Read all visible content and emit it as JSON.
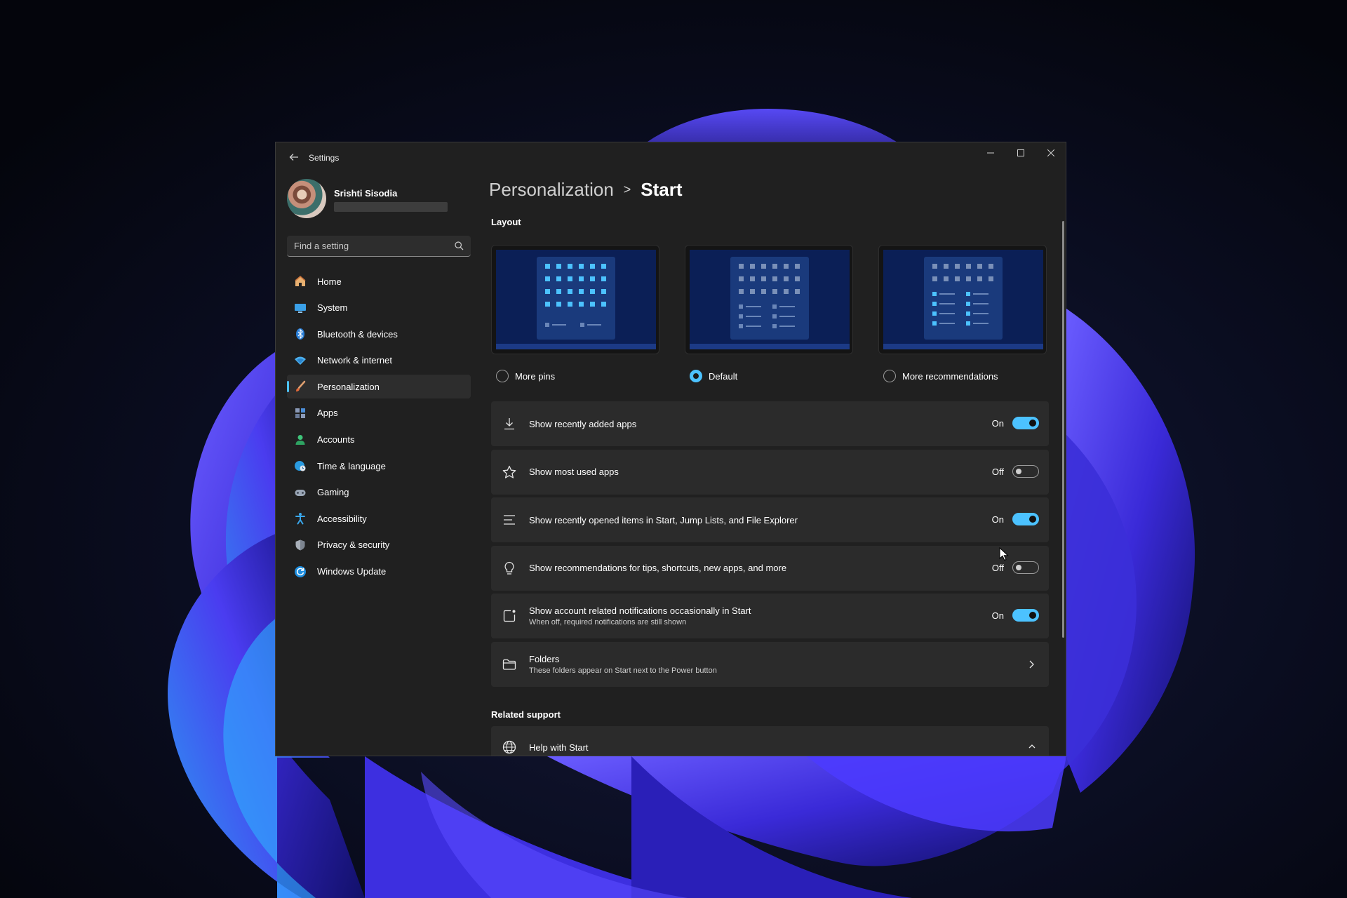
{
  "app": {
    "title": "Settings",
    "accent_color": "#4cc2ff"
  },
  "window_controls": [
    "minimize-icon",
    "maximize-icon",
    "close-icon"
  ],
  "profile": {
    "name": "Srishti Sisodia"
  },
  "search": {
    "placeholder": "Find a setting"
  },
  "sidebar": {
    "items": [
      {
        "label": "Home",
        "icon": "home-icon",
        "selected": false
      },
      {
        "label": "System",
        "icon": "system-icon",
        "selected": false
      },
      {
        "label": "Bluetooth & devices",
        "icon": "bluetooth-icon",
        "selected": false
      },
      {
        "label": "Network & internet",
        "icon": "wifi-icon",
        "selected": false
      },
      {
        "label": "Personalization",
        "icon": "brush-icon",
        "selected": true
      },
      {
        "label": "Apps",
        "icon": "apps-icon",
        "selected": false
      },
      {
        "label": "Accounts",
        "icon": "person-icon",
        "selected": false
      },
      {
        "label": "Time & language",
        "icon": "globe-clock-icon",
        "selected": false
      },
      {
        "label": "Gaming",
        "icon": "gamepad-icon",
        "selected": false
      },
      {
        "label": "Accessibility",
        "icon": "accessibility-icon",
        "selected": false
      },
      {
        "label": "Privacy & security",
        "icon": "shield-icon",
        "selected": false
      },
      {
        "label": "Windows Update",
        "icon": "update-icon",
        "selected": false
      }
    ]
  },
  "breadcrumb": {
    "parent": "Personalization",
    "separator": ">",
    "current": "Start"
  },
  "layout_section": {
    "title": "Layout",
    "options": [
      {
        "label": "More pins",
        "checked": false
      },
      {
        "label": "Default",
        "checked": true
      },
      {
        "label": "More recommendations",
        "checked": false
      }
    ]
  },
  "settings": [
    {
      "icon": "download-icon",
      "title": "Show recently added apps",
      "desc": "",
      "state": "On",
      "on": true
    },
    {
      "icon": "star-icon",
      "title": "Show most used apps",
      "desc": "",
      "state": "Off",
      "on": false
    },
    {
      "icon": "list-icon",
      "title": "Show recently opened items in Start, Jump Lists, and File Explorer",
      "desc": "",
      "state": "On",
      "on": true
    },
    {
      "icon": "lightbulb-icon",
      "title": "Show recommendations for tips, shortcuts, new apps, and more",
      "desc": "",
      "state": "Off",
      "on": false
    },
    {
      "icon": "notification-badge-icon",
      "title": "Show account related notifications occasionally in Start",
      "desc": "When off, required notifications are still shown",
      "state": "On",
      "on": true
    }
  ],
  "folders": {
    "icon": "folder-icon",
    "title": "Folders",
    "desc": "These folders appear on Start next to the Power button"
  },
  "related_support": {
    "title": "Related support",
    "help_title": "Help with Start"
  }
}
